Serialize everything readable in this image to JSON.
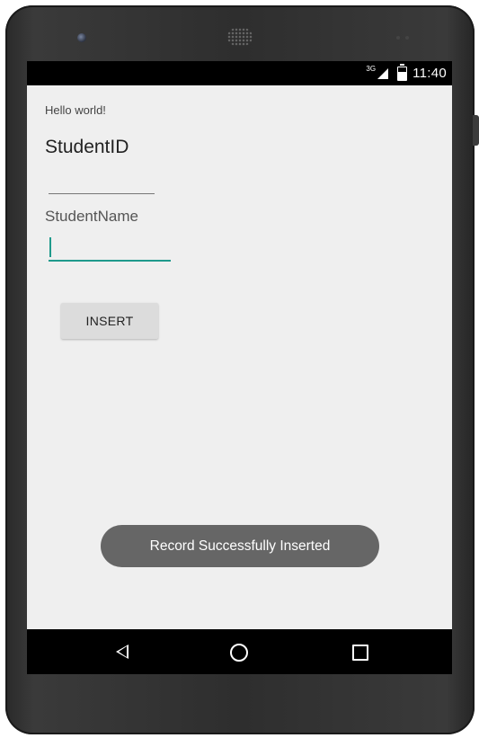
{
  "status_bar": {
    "network_type": "3G",
    "time": "11:40"
  },
  "app": {
    "hello_text": "Hello world!",
    "student_id_label": "StudentID",
    "student_id_value": "",
    "student_name_label": "StudentName",
    "student_name_value": "",
    "insert_button_label": "INSERT"
  },
  "toast": {
    "message": "Record Successfully Inserted"
  },
  "nav_bar": {
    "icons": [
      "back-icon",
      "home-icon",
      "recents-icon"
    ]
  },
  "colors": {
    "accent": "#1f9a8c",
    "screen_background": "#efefef",
    "toast_background": "#666666"
  }
}
